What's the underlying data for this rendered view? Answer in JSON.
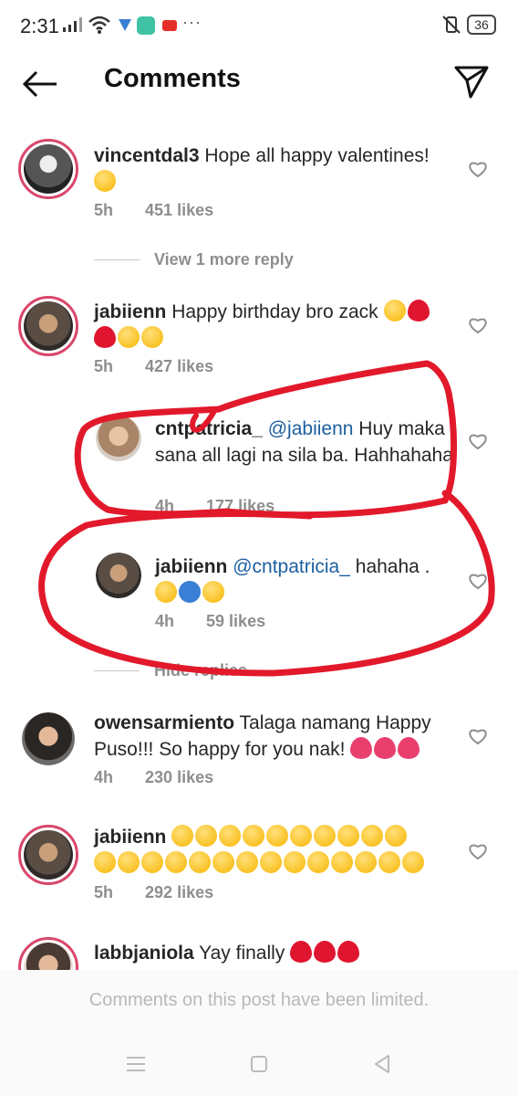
{
  "status_bar": {
    "time": "2:31",
    "battery": "36"
  },
  "header": {
    "title": "Comments"
  },
  "comments": [
    {
      "user": "vincentdal3",
      "text": "Hope all happy valentines!",
      "time": "5h",
      "likes": "451 likes",
      "view_replies": "View 1 more reply"
    },
    {
      "user": "jabiienn",
      "text": "Happy birthday bro zack",
      "time": "5h",
      "likes": "427 likes"
    },
    {
      "user": "cntpatricia_",
      "mention": "@jabiienn",
      "text": "Huy maka sana all lagi na sila ba. Hahhahaha",
      "time": "4h",
      "likes": "177 likes"
    },
    {
      "user": "jabiienn",
      "mention": "@cntpatricia_",
      "text": "hahaha .",
      "time": "4h",
      "likes": "59 likes",
      "hide_replies": "Hide replies"
    },
    {
      "user": "owensarmiento",
      "text": "Talaga namang Happy Puso!!! So happy for you nak!",
      "time": "4h",
      "likes": "230 likes"
    },
    {
      "user": "jabiienn",
      "text": "",
      "time": "5h",
      "likes": "292 likes"
    },
    {
      "user": "labbjaniola",
      "text": "Yay finally"
    }
  ],
  "footer": {
    "limited_text": "Comments on this post have been limited."
  },
  "icons": {
    "back": "arrow-left-icon",
    "send": "direct-message-icon",
    "like": "heart-outline-icon",
    "nav": [
      "menu-icon",
      "home-square-icon",
      "back-triangle-icon"
    ]
  },
  "colors": {
    "mention": "#1d5fa0",
    "annotation": "#e2192b",
    "meta": "#8e8e8e"
  }
}
